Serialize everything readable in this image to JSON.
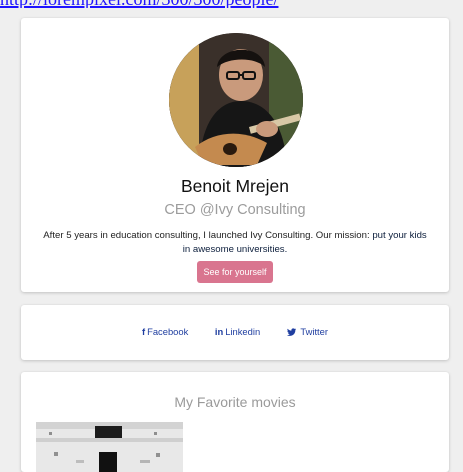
{
  "top_link_text": "http://lorempixel.com/300/300/people/",
  "profile": {
    "name": "Benoit Mrejen",
    "role": "CEO @Ivy Consulting",
    "bio_prefix": "After 5 years in education consulting, I launched Ivy Consulting. Our mission: ",
    "bio_highlight": "put your kids in awesome universities.",
    "cta_label": "See for yourself"
  },
  "social": {
    "facebook": {
      "icon": "f",
      "label": "Facebook"
    },
    "linkedin": {
      "icon": "in",
      "label": "Linkedin"
    },
    "twitter": {
      "icon": "twitter-bird",
      "label": "Twitter"
    }
  },
  "movies": {
    "title": "My Favorite movies"
  },
  "colors": {
    "background": "#efefef",
    "card": "#ffffff",
    "cta": "#d9758f",
    "link": "#1f3ea0",
    "top_link": "#1f14ff"
  }
}
